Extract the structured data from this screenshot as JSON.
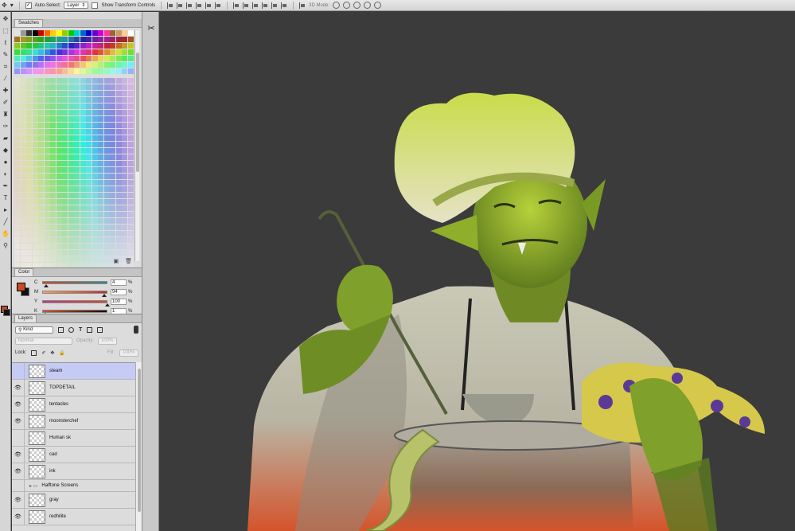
{
  "options_bar": {
    "move_tool": "move-icon",
    "auto_select_label": "Auto-Select:",
    "auto_select_checked": true,
    "target_value": "Layer",
    "show_transform_label": "Show Transform Controls",
    "show_transform_checked": false,
    "mode_3d_label": "3D Mode:"
  },
  "swatches_panel": {
    "tab_label": "Swatches"
  },
  "color_panel": {
    "tab_label": "Color",
    "foreground_color": "#c64a24",
    "background_color": "#111111",
    "channels": [
      {
        "label": "C",
        "value": "4",
        "unit": "%"
      },
      {
        "label": "M",
        "value": "94",
        "unit": "%"
      },
      {
        "label": "Y",
        "value": "100",
        "unit": "%"
      },
      {
        "label": "K",
        "value": "1",
        "unit": "%"
      }
    ]
  },
  "layers_panel": {
    "tab_label": "Layers",
    "filter_kind": "Kind",
    "blend_mode": "Normal",
    "opacity_label": "Opacity:",
    "opacity_value": "100%",
    "lock_label": "Lock:",
    "fill_label": "Fill:",
    "fill_value": "100%",
    "layers": [
      {
        "name": "steam",
        "visible": false,
        "selected": true,
        "type": "layer"
      },
      {
        "name": "TOPDETAIL",
        "visible": true,
        "selected": false,
        "type": "layer"
      },
      {
        "name": "tentacles",
        "visible": true,
        "selected": false,
        "type": "layer"
      },
      {
        "name": "moonsterchef",
        "visible": true,
        "selected": false,
        "type": "layer"
      },
      {
        "name": "Human sk",
        "visible": false,
        "selected": false,
        "type": "layer"
      },
      {
        "name": "cad",
        "visible": true,
        "selected": false,
        "type": "layer"
      },
      {
        "name": "ink",
        "visible": true,
        "selected": false,
        "type": "layer"
      },
      {
        "name": "Halftone Screens",
        "visible": false,
        "selected": false,
        "type": "group"
      },
      {
        "name": "gray",
        "visible": true,
        "selected": false,
        "type": "layer"
      },
      {
        "name": "redhilite",
        "visible": true,
        "selected": false,
        "type": "layer"
      }
    ]
  },
  "accent_colors": {
    "canvas_bg": "#3b3b3b",
    "skin_green": "#9bbd2c",
    "apron_orange": "#d0502a",
    "octopus_purple": "#5a3a96"
  }
}
